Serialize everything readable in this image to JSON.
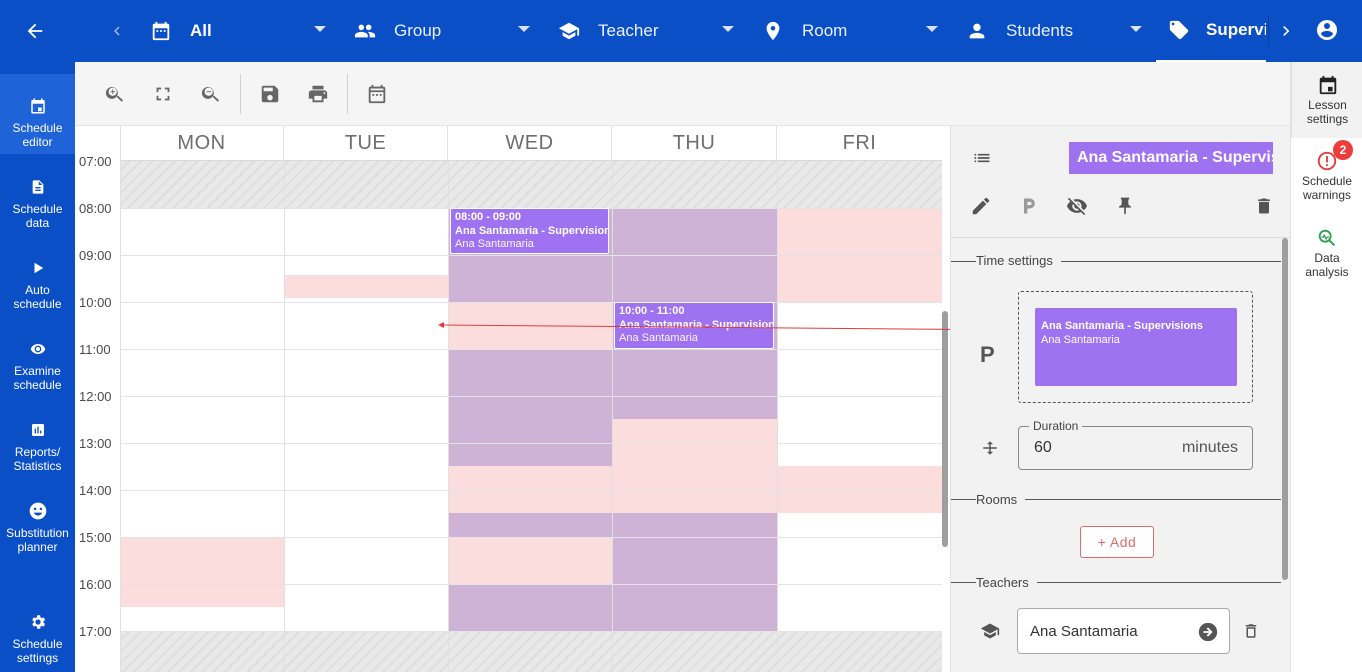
{
  "topbar": {
    "filters": [
      {
        "label": "All",
        "icon": "calendar-icon"
      },
      {
        "label": "Group",
        "icon": "group-icon"
      },
      {
        "label": "Teacher",
        "icon": "school-icon"
      },
      {
        "label": "Room",
        "icon": "location-pin-icon"
      },
      {
        "label": "Students",
        "icon": "person-icon"
      },
      {
        "label": "Supervis",
        "icon": "tag-icon"
      }
    ]
  },
  "leftnav": {
    "items": [
      {
        "label": "Schedule\neditor",
        "icon": "calendar-icon"
      },
      {
        "label": "Schedule\ndata",
        "icon": "document-icon"
      },
      {
        "label": "Auto\nschedule",
        "icon": "play-icon"
      },
      {
        "label": "Examine\nschedule",
        "icon": "eye-icon"
      },
      {
        "label": "Reports/\nStatistics",
        "icon": "chart-icon"
      },
      {
        "label": "Substitution\nplanner",
        "icon": "face-icon"
      },
      {
        "label": "Schedule\nsettings",
        "icon": "gear-icon"
      }
    ]
  },
  "calendar": {
    "days": [
      "MON",
      "TUE",
      "WED",
      "THU",
      "FRI"
    ],
    "times": [
      "07:00",
      "08:00",
      "09:00",
      "10:00",
      "11:00",
      "12:00",
      "13:00",
      "14:00",
      "15:00",
      "16:00",
      "17:00"
    ],
    "lessons": [
      {
        "time": "08:00 - 09:00",
        "name": "Ana Santamaria - Supervisions",
        "teacher": "Ana Santamaria"
      },
      {
        "time": "10:00 - 11:00",
        "name": "Ana Santamaria - Supervisions",
        "teacher": "Ana Santamaria"
      }
    ]
  },
  "panel": {
    "title": "Ana Santamaria - Supervisions",
    "time_settings_label": "Time settings",
    "drop_card": {
      "name": "Ana Santamaria - Supervisions",
      "teacher": "Ana Santamaria"
    },
    "p_letter": "P",
    "duration_label": "Duration",
    "duration_value": "60",
    "duration_unit": "minutes",
    "rooms_label": "Rooms",
    "add_label": "+ Add",
    "teachers_label": "Teachers",
    "teacher_value": "Ana Santamaria"
  },
  "rightside": {
    "items": [
      {
        "label": "Lesson\nsettings"
      },
      {
        "label": "Schedule\nwarnings",
        "badge": "2"
      },
      {
        "label": "Data\nanalysis"
      }
    ]
  },
  "colors": {
    "primary": "#0b4fc7",
    "lesson": "#9e72f0",
    "unavailable_pink": "#fbdddd",
    "busy_purple": "#cfb3d6",
    "warning_red": "#f03b3b",
    "data_green": "#2e9e4f"
  }
}
